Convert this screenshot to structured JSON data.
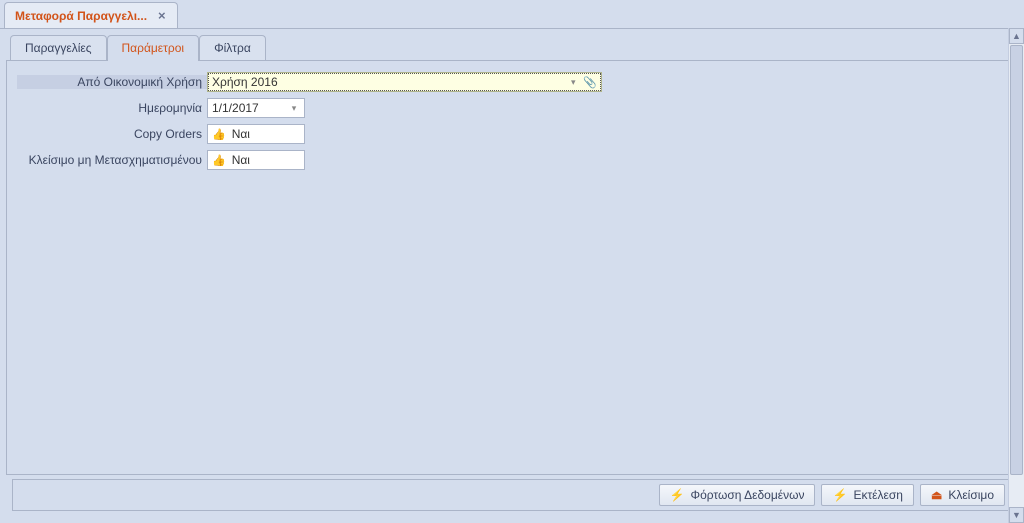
{
  "doc_tab": {
    "title": "Μεταφορά Παραγγελι...",
    "close": "×"
  },
  "tabs": {
    "orders": "Παραγγελίες",
    "params": "Παράμετροι",
    "filters": "Φίλτρα"
  },
  "labels": {
    "fiscal": "Από Οικονομική Χρήση",
    "date": "Ημερομηνία",
    "copy": "Copy Orders",
    "close_untransformed": "Κλείσιμο μη Μετασχηματισμένου"
  },
  "fields": {
    "fiscal_value": "Χρήση 2016",
    "date_value": "1/1/2017",
    "copy_value": "Ναι",
    "close_untransformed_value": "Ναι"
  },
  "buttons": {
    "load": "Φόρτωση Δεδομένων",
    "run": "Εκτέλεση",
    "close": "Κλείσιμο"
  },
  "icons": {
    "dropdown": "▾",
    "pin": "📎",
    "thumb": "👍",
    "bolt": "⚡",
    "eject": "⏏",
    "up": "▲",
    "down": "▼"
  }
}
